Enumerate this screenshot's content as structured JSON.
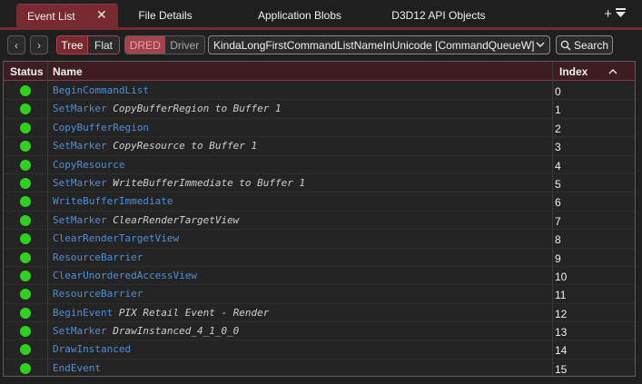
{
  "tabs": [
    {
      "label": "Event List",
      "close": "✕"
    },
    {
      "label": "File Details"
    },
    {
      "label": "Application Blobs"
    },
    {
      "label": "D3D12 API Objects"
    }
  ],
  "tabbar_icons": {
    "add": "+",
    "menu": "chevron-down-bar-icon"
  },
  "toolbar": {
    "back": "‹",
    "forward": "›",
    "tree_label": "Tree",
    "flat_label": "Flat",
    "dred_label": "DRED",
    "driver_label": "Driver",
    "command_list": "KindaLongFirstCommandListNameInUnicode [CommandQueueW]",
    "search_label": "Search"
  },
  "grid": {
    "columns": {
      "status": "Status",
      "name": "Name",
      "index": "Index"
    },
    "rows": [
      {
        "name": "BeginCommandList",
        "arg": "",
        "index": "0",
        "status": "#2ed21e"
      },
      {
        "name": "SetMarker",
        "arg": "CopyBufferRegion to Buffer 1",
        "index": "1",
        "status": "#2ed21e"
      },
      {
        "name": "CopyBufferRegion",
        "arg": "",
        "index": "2",
        "status": "#2ed21e"
      },
      {
        "name": "SetMarker",
        "arg": "CopyResource to Buffer 1",
        "index": "3",
        "status": "#2ed21e"
      },
      {
        "name": "CopyResource",
        "arg": "",
        "index": "4",
        "status": "#2ed21e"
      },
      {
        "name": "SetMarker",
        "arg": "WriteBufferImmediate to Buffer 1",
        "index": "5",
        "status": "#2ed21e"
      },
      {
        "name": "WriteBufferImmediate",
        "arg": "",
        "index": "6",
        "status": "#2ed21e"
      },
      {
        "name": "SetMarker",
        "arg": "ClearRenderTargetView",
        "index": "7",
        "status": "#2ed21e"
      },
      {
        "name": "ClearRenderTargetView",
        "arg": "",
        "index": "8",
        "status": "#2ed21e"
      },
      {
        "name": "ResourceBarrier",
        "arg": "",
        "index": "9",
        "status": "#2ed21e"
      },
      {
        "name": "ClearUnorderedAccessView",
        "arg": "",
        "index": "10",
        "status": "#2ed21e"
      },
      {
        "name": "ResourceBarrier",
        "arg": "",
        "index": "11",
        "status": "#2ed21e"
      },
      {
        "name": "BeginEvent",
        "arg": "PIX Retail Event - Render",
        "index": "12",
        "status": "#2ed21e"
      },
      {
        "name": "SetMarker",
        "arg": "DrawInstanced_4_1_0_0",
        "index": "13",
        "status": "#2ed21e"
      },
      {
        "name": "DrawInstanced",
        "arg": "",
        "index": "14",
        "status": "#2ed21e"
      },
      {
        "name": "EndEvent",
        "arg": "",
        "index": "15",
        "status": "#2ed21e"
      }
    ]
  },
  "colors": {
    "accent": "#782a31",
    "status_ok": "#2ed21e",
    "api_name": "#4f8fd8"
  }
}
